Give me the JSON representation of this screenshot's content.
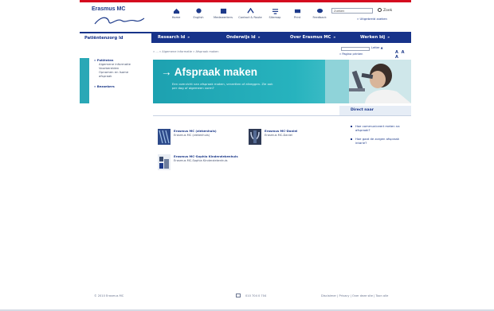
{
  "header": {
    "logo_text": "Erasmus MC",
    "logo_tagline": "Zafing",
    "toolbar": [
      {
        "label": "Home",
        "icon": "home-icon"
      },
      {
        "label": "English",
        "icon": "globe-icon"
      },
      {
        "label": "Medewerkers",
        "icon": "building-icon"
      },
      {
        "label": "Contact & Route",
        "icon": "route-icon"
      },
      {
        "label": "Sitemap",
        "icon": "sitemap-icon"
      },
      {
        "label": "Print",
        "icon": "print-icon"
      },
      {
        "label": "Feedback",
        "icon": "feedback-icon"
      }
    ],
    "search_placeholder": "Zoeken",
    "search_button": "Zoek",
    "advanced_search": "» Uitgebreid zoeken"
  },
  "nav": [
    {
      "label": "Patiëntenzorg ld",
      "arrow": "",
      "active": true
    },
    {
      "label": "Research ld",
      "arrow": "»"
    },
    {
      "label": "Onderwijs ld",
      "arrow": "»"
    },
    {
      "label": "Over Erasmus MC",
      "arrow": "»"
    },
    {
      "label": "Werken bij",
      "arrow": "»"
    }
  ],
  "sidebar": {
    "items": [
      {
        "label": "» Patiënten",
        "kind": "head"
      },
      {
        "label": "Algemene informatie",
        "kind": "sub"
      },
      {
        "label": "Voorbereiden",
        "kind": "sub"
      },
      {
        "label": "Opnamen en Isame",
        "kind": "sub"
      },
      {
        "label": "afspraak",
        "kind": "sub"
      },
      {
        "label": "» Bezoekers",
        "kind": "head"
      }
    ]
  },
  "breadcrumb": "» ... » Algemene informatie » Afspraak maken",
  "utility": {
    "font_label": "Letter ▲",
    "print_link": "» Pagina printen",
    "size_buttons": "A A A"
  },
  "hero": {
    "title": "→ Afspraak maken",
    "intro": "Een overzicht van afspraak maken, verzetten of afzeggen. Zie ook per dag of algemeen vorm?"
  },
  "direct": {
    "title": "Direct naar",
    "links": [
      "Hoe communiceert meten na afspraak?",
      "Hoe gaat de zorgen afspraak intarie?"
    ]
  },
  "cards": [
    {
      "title": "Erasmus MC (ziekenhuis)",
      "subtitle": "Erasmus MC (ziekenhuis)"
    },
    {
      "title": "Erasmus MC-Daniel",
      "subtitle": "Erasmus MC-Daniel"
    },
    {
      "title": "Erasmus MC-Sophia Kinderziekenhuis",
      "subtitle": "Erasmus MC-Sophia Kinderziekenhuis"
    }
  ],
  "footer": {
    "copyright": "© 2010 Erasmus MC",
    "phone": "010 704 0 704",
    "links": "Disclaimer | Privacy | Over deze site | Toon alle"
  },
  "colors": {
    "red_bar": "#d40b1f",
    "nav": "#17338a",
    "teal": "#1da1b0"
  }
}
